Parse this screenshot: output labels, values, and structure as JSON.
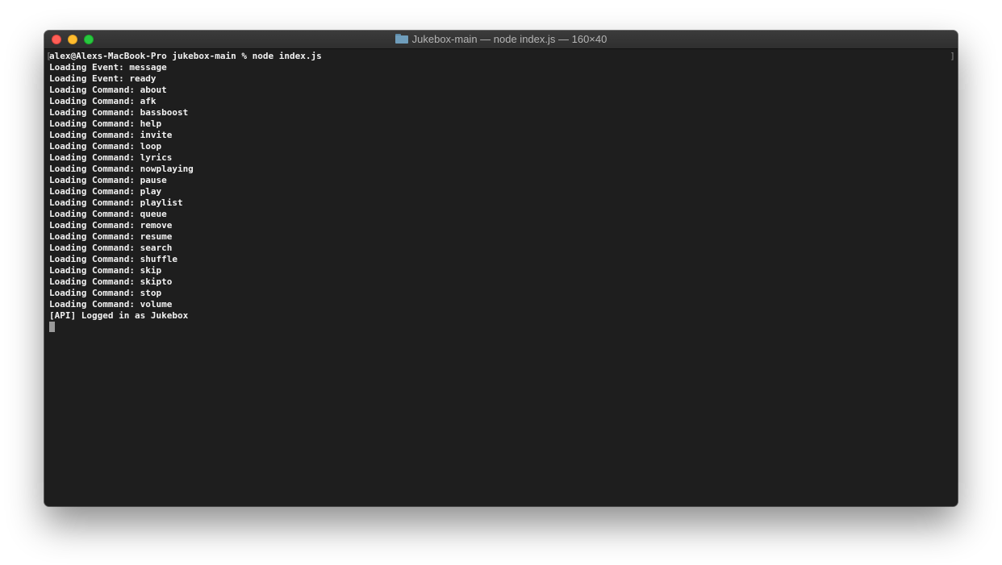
{
  "window": {
    "title": "Jukebox-main — node index.js — 160×40",
    "folder_icon": "folder-icon"
  },
  "terminal": {
    "prompt": "alex@Alexs-MacBook-Pro jukebox-main % node index.js",
    "lines": [
      "Loading Event: message",
      "Loading Event: ready",
      "Loading Command: about",
      "Loading Command: afk",
      "Loading Command: bassboost",
      "Loading Command: help",
      "Loading Command: invite",
      "Loading Command: loop",
      "Loading Command: lyrics",
      "Loading Command: nowplaying",
      "Loading Command: pause",
      "Loading Command: play",
      "Loading Command: playlist",
      "Loading Command: queue",
      "Loading Command: remove",
      "Loading Command: resume",
      "Loading Command: search",
      "Loading Command: shuffle",
      "Loading Command: skip",
      "Loading Command: skipto",
      "Loading Command: stop",
      "Loading Command: volume",
      "[API] Logged in as Jukebox"
    ],
    "bracket_left": "[",
    "bracket_right": "]"
  },
  "colors": {
    "background": "#1e1e1e",
    "text": "#f2f2f2",
    "close": "#fe5f57",
    "minimize": "#febc2e",
    "maximize": "#28c840"
  }
}
